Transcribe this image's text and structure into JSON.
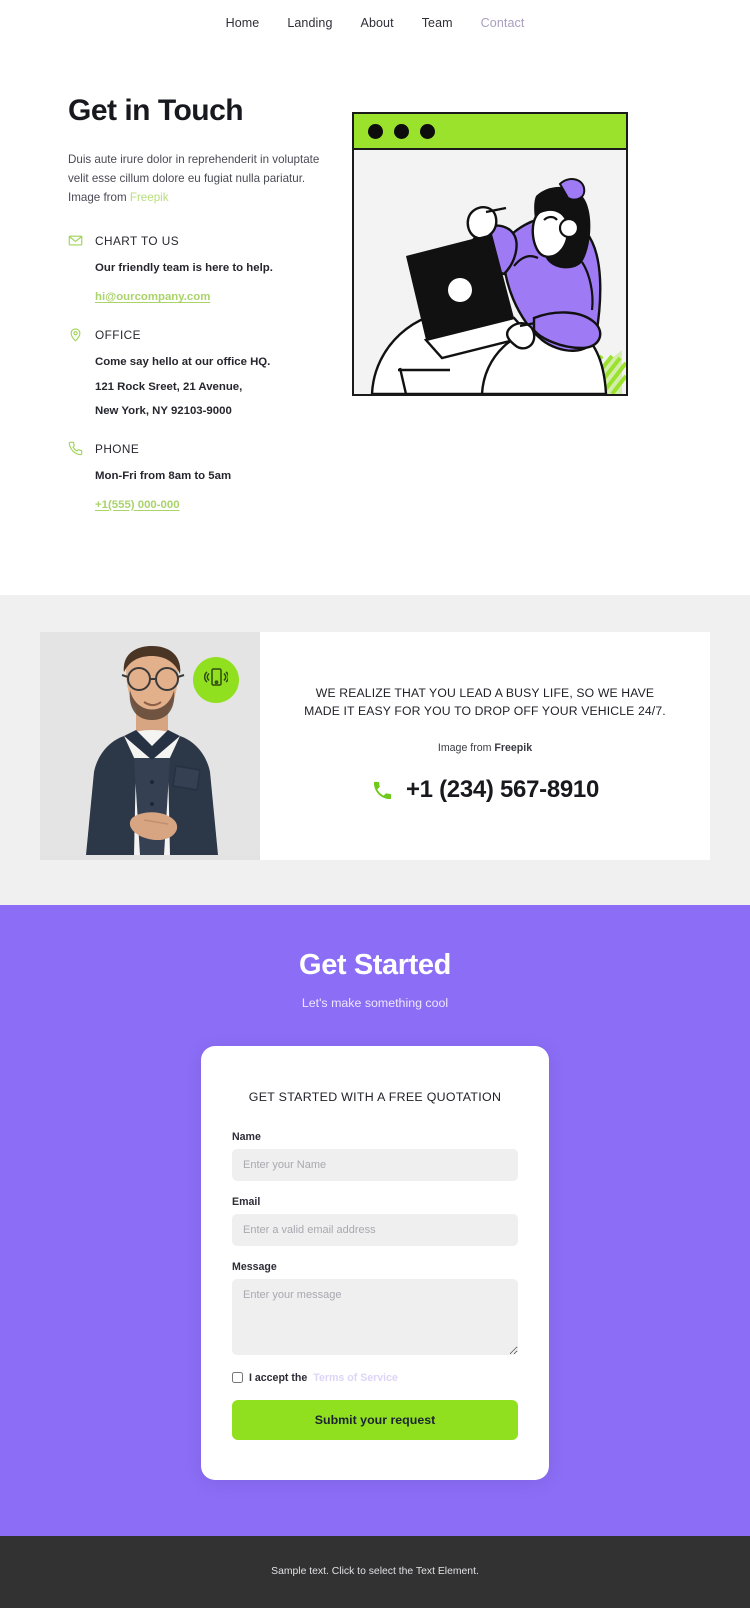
{
  "nav": {
    "items": [
      {
        "label": "Home",
        "active": false
      },
      {
        "label": "Landing",
        "active": false
      },
      {
        "label": "About",
        "active": false
      },
      {
        "label": "Team",
        "active": false
      },
      {
        "label": "Contact",
        "active": true
      }
    ]
  },
  "hero": {
    "title": "Get in Touch",
    "description": "Duis aute irure dolor in reprehenderit in voluptate velit esse cillum dolore eu fugiat nulla pariatur. Image from ",
    "credit_link": "Freepik",
    "blocks": [
      {
        "icon": "envelope-icon",
        "title": "CHART TO US",
        "lines": [
          "Our friendly team is here to help."
        ],
        "link": "hi@ourcompany.com"
      },
      {
        "icon": "location-pin-icon",
        "title": "OFFICE",
        "lines": [
          "Come say hello at our office HQ.",
          "121 Rock Sreet, 21 Avenue,",
          "New York, NY 92103-9000"
        ],
        "link": ""
      },
      {
        "icon": "phone-icon",
        "title": "PHONE",
        "lines": [
          "Mon-Fri from 8am to 5am"
        ],
        "link": "+1(555) 000-000"
      }
    ],
    "illustration": {
      "alt": "person-with-laptop-illustration",
      "dots": 3,
      "bar_color": "#9ae22b"
    }
  },
  "midsection": {
    "photo_alt": "man-with-glasses-photo",
    "badge_icon": "vibrating-mobile-icon",
    "headline": "WE REALIZE THAT YOU LEAD A BUSY LIFE, SO WE HAVE MADE IT EASY FOR YOU TO DROP OFF YOUR VEHICLE 24/7.",
    "credit_prefix": "Image from ",
    "credit_source": "Freepik",
    "phone": "+1 (234) 567-8910",
    "phone_icon": "phone-handset-icon"
  },
  "cta": {
    "title": "Get Started",
    "subtitle": "Let's make something cool",
    "form": {
      "title": "GET STARTED WITH A FREE QUOTATION",
      "name_label": "Name",
      "name_placeholder": "Enter your Name",
      "name_value": "",
      "email_label": "Email",
      "email_placeholder": "Enter a valid email address",
      "email_value": "",
      "message_label": "Message",
      "message_placeholder": "Enter your message",
      "message_value": "",
      "terms_text": "I accept the",
      "terms_link": "Terms of Service",
      "terms_checked": false,
      "submit_label": "Submit your request"
    }
  },
  "footer": {
    "text": "Sample text. Click to select the Text Element."
  },
  "colors": {
    "accent_green": "#90e01f",
    "light_green": "#aad36b",
    "purple": "#8b6ef5",
    "illustration_purple": "#9f7af5",
    "dark": "#18181f",
    "footer_bg": "#323232",
    "gray_section": "#f0f0f0"
  }
}
